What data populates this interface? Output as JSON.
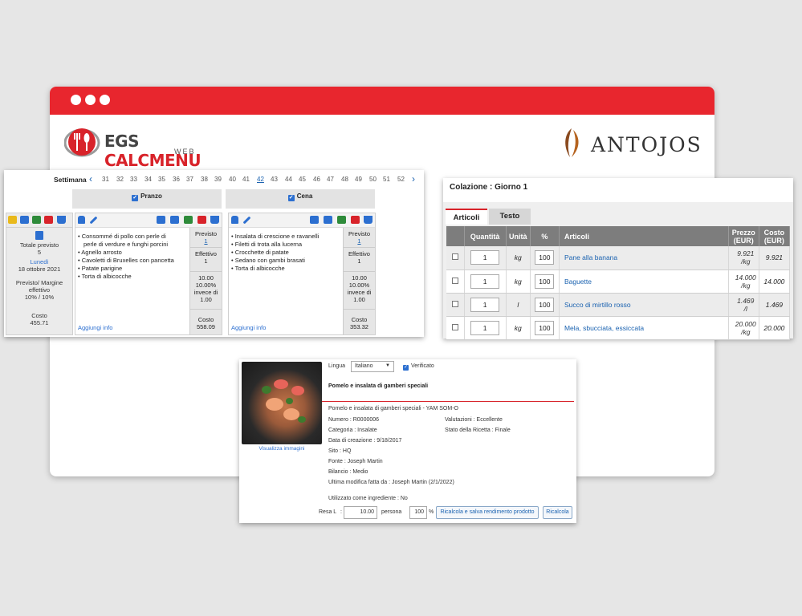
{
  "brand": {
    "logo_main": "EGS",
    "logo_accent": "CALCMENU",
    "logo_sub": "WEB",
    "client_logo": "ANTOJOS"
  },
  "weekly": {
    "week_label": "Settimana",
    "weeks": [
      "31",
      "32",
      "33",
      "34",
      "35",
      "36",
      "37",
      "38",
      "39",
      "40",
      "41",
      "42",
      "43",
      "44",
      "45",
      "46",
      "47",
      "48",
      "49",
      "50",
      "51",
      "52"
    ],
    "active_week": "42",
    "summary": {
      "total_label": "Totale previsto",
      "total_value": "5",
      "day": "Lunedì",
      "date": "18 ottobre 2021",
      "margin_label": "Previsto/ Margine effettivo",
      "margin_value": "10% / 10%",
      "cost_label": "Costo",
      "cost_value": "455.71"
    },
    "meals": [
      {
        "name": "Pranzo",
        "items": [
          "Consommé di pollo con perle di",
          "perle di verdure e funghi porcini",
          "Agnello arrosto",
          "Cavoletti di Bruxelles con pancetta",
          "Patate parigine",
          "Torta di albicocche"
        ],
        "previsto_label": "Previsto",
        "previsto_value": "1",
        "effettivo_label": "Effettivo",
        "effettivo_value": "1",
        "margin_lines": [
          "10.00",
          "10.00%",
          "invece di",
          "1.00"
        ],
        "cost_label": "Costo",
        "cost_value": "558.09",
        "add_info": "Aggiungi info"
      },
      {
        "name": "Cena",
        "items": [
          "Insalata di crescione e ravanelli",
          "Filetti di trota alla lucerna",
          "Crocchette di patate",
          "Sedano con gambi brasati",
          "Torta di albicocche"
        ],
        "previsto_label": "Previsto",
        "previsto_value": "1",
        "effettivo_label": "Effettivo",
        "effettivo_value": "1",
        "margin_lines": [
          "10.00",
          "10.00%",
          "invece di",
          "1.00"
        ],
        "cost_label": "Costo",
        "cost_value": "353.32",
        "add_info": "Aggiungi info"
      }
    ]
  },
  "colazione": {
    "title": "Colazione : Giorno 1",
    "tabs": [
      "Articoli",
      "Testo"
    ],
    "headers": [
      "Quantità",
      "Unità",
      "%",
      "Articoli",
      "Prezzo (EUR)",
      "Costo (EUR)"
    ],
    "rows": [
      {
        "qty": "1",
        "unit": "kg",
        "pct": "100",
        "item": "Pane alla banana",
        "price": "9.921",
        "price_unit": "/kg",
        "cost": "9.921"
      },
      {
        "qty": "1",
        "unit": "kg",
        "pct": "100",
        "item": "Baguette",
        "price": "14.000",
        "price_unit": "/kg",
        "cost": "14.000"
      },
      {
        "qty": "1",
        "unit": "l",
        "pct": "100",
        "item": "Succo di mirtillo rosso",
        "price": "1.469",
        "price_unit": "/l",
        "cost": "1.469"
      },
      {
        "qty": "1",
        "unit": "kg",
        "pct": "100",
        "item": "Mela, sbucciata, essiccata",
        "price": "20.000",
        "price_unit": "/kg",
        "cost": "20.000"
      }
    ]
  },
  "recipe": {
    "language_label": "Lingua",
    "language_value": "Italiano",
    "verified_label": "Verificato",
    "title": "Pomelo e insalata di gamberi speciali",
    "subtitle": "Pomelo e insalata di gamberi speciali - YAM SOM-O",
    "numero": "Numero : R0000006",
    "valutazioni": "Valutazioni : Eccellente",
    "categoria": "Categoria : Insalate",
    "stato": "Stato della Ricetta : Finale",
    "data_creazione": "Data di creazione : 9/18/2017",
    "sito": "Sito : HQ",
    "fonte": "Fonte : Joseph Martin",
    "bilancio": "Bilancio : Medio",
    "ultima_modifica": "Ultima modifica fatta da : Joseph Martin (2/1/2022)",
    "utilizzato": "Utilizzato come ingrediente : No",
    "view_images": "Visualizza immagini",
    "resa_label": "Resa L",
    "resa_colon": ":",
    "resa_value": "10.00",
    "persona_label": "persona",
    "pct_value": "100",
    "pct_sign": "%",
    "btn_recalc_save": "Ricalcola e salva rendimento prodotto",
    "btn_recalc": "Ricalcola"
  },
  "colors": {
    "brand_red": "#e8262e",
    "link_blue": "#1a62b0",
    "header_gray": "#7d7d7d"
  }
}
